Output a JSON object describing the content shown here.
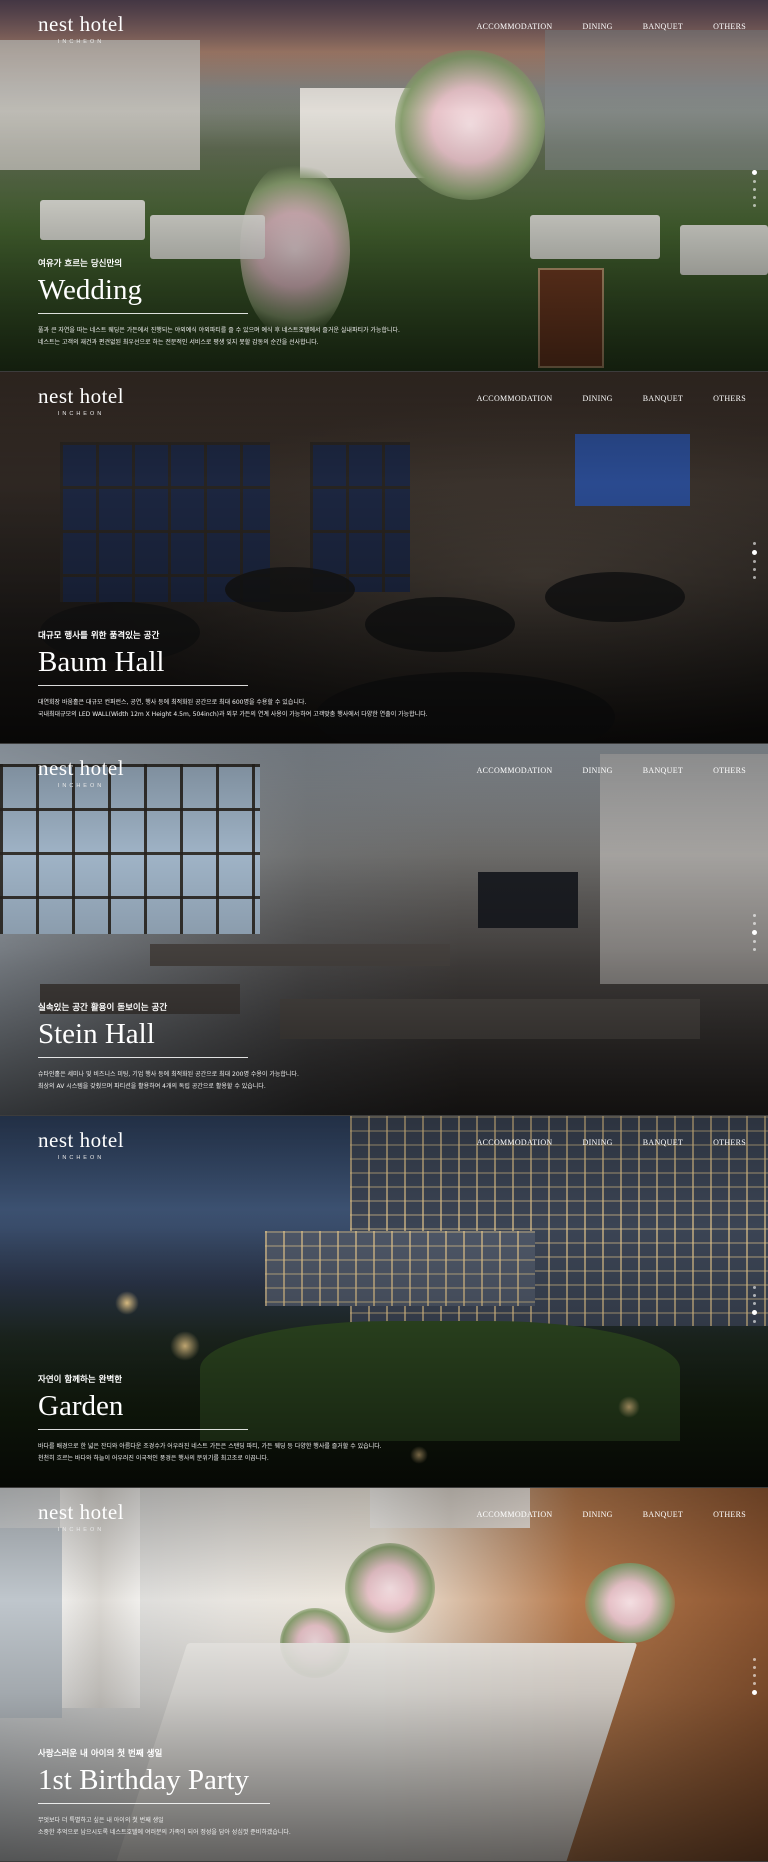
{
  "brand": {
    "name": "nest hotel",
    "location": "INCHEON"
  },
  "nav": [
    "ACCOMMODATION",
    "DINING",
    "BANQUET",
    "OTHERS"
  ],
  "sections": [
    {
      "eyebrow": "여유가 흐르는 당신만의",
      "title": "Wedding",
      "description": [
        "풀과 큰 자연을 따는 네스트 웨딩은 가든에서 진행되는 야외예식 야외파티를 즐 수 있으며 예식 후 네스트호텔에서 즐거운 실내파티가 가능합니다.",
        "네스트는 고객의 재건과 편견없된 최우선으로 하는 전문적인 서비스로 평생 잊지 못할 감동의 순간을 선사합니다."
      ],
      "active_dot": 0
    },
    {
      "eyebrow": "대규모 행사를 위한 품격있는 공간",
      "title": "Baum Hall",
      "description": [
        "대연회장 바움홀은 대규모 컨퍼런스, 공연, 행사 등에 최적화된 공간으로 최대 600명을 수용할 수 있습니다.",
        "국내최대규모의 LED WALL(Width 12m X Height 4.5m, 504inch)과 외부 가든의 연계 사용이 가능하여 고객맞춤 행사에서 다양한 연출이 가능합니다."
      ],
      "active_dot": 1
    },
    {
      "eyebrow": "실속있는 공간 활용이 돋보이는 공간",
      "title": "Stein Hall",
      "description": [
        "슈타인홀은 세미나 및 비즈니스 미팅, 기업 행사 등에 최적화된 공간으로 최대 200명 수용이 가능합니다.",
        "최상의 AV 시스템을 갖췄으며 파티션을 활용하여 4개의 독립 공간으로 활용할 수 있습니다."
      ],
      "active_dot": 2
    },
    {
      "eyebrow": "자연이 함께하는 완벽한",
      "title": "Garden",
      "description": [
        "바다를 배경으로 한 넓은 잔디와 아름다운 조경수가 어우러진 네스트 가든은 스탠딩 파티, 가든 웨딩 등 다양한 행사를 즐거할 수 있습니다.",
        "천천히 흐르는 바다와 하늘이 어우러진 이국적인 풍경은 행사의 분위기를 최고조로 이끕니다."
      ],
      "active_dot": 3
    },
    {
      "eyebrow": "사랑스러운 내 아이의 첫 번째 생일",
      "title": "1st Birthday Party",
      "description": [
        "무엇보다 더 특별하고 싶은 내 아이의 첫 번째 생일",
        "소중한 추억으로 남으시도록 네스트호텔에 여러분의 가족이 되어 정성을 담아 성심껏 준비하겠습니다."
      ],
      "active_dot": 4
    }
  ],
  "colors": {
    "text": "#ffffff",
    "overlay": "#000000"
  },
  "dot_count": 5
}
